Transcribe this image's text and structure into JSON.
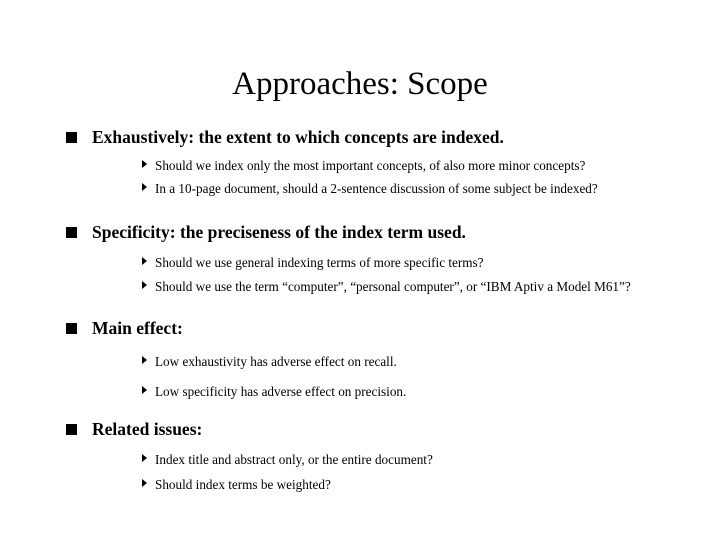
{
  "slide": {
    "title": "Approaches: Scope",
    "background_color": "#ffffff",
    "text_color": "#000000",
    "bullet_markers": {
      "level1": "filled-square-bullet",
      "level2": "right-triangle-bullet"
    },
    "sections": [
      {
        "heading": "Exhaustively: the extent to which concepts are indexed.",
        "items": [
          "Should  we index only the most important concepts, of also more minor concepts?",
          "In a 10-page document, should a 2-sentence discussion of some subject be indexed?"
        ]
      },
      {
        "heading": "Specificity: the preciseness of the index term used.",
        "items": [
          "Should we use general indexing terms of more specific terms?",
          "Should we use the term “computer”, “personal computer”, or “IBM Aptiv a Model M61”?"
        ]
      },
      {
        "heading": "Main effect:",
        "items": [
          "Low exhaustivity has adverse effect on recall.",
          "Low specificity has adverse effect on precision."
        ]
      },
      {
        "heading": "Related issues:",
        "items": [
          "Index title and abstract only, or the entire document?",
          "Should index terms be weighted?"
        ]
      }
    ]
  }
}
